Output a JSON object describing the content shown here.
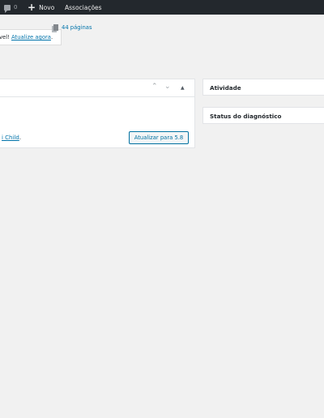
{
  "admin_bar": {
    "comments_count": "0",
    "new_label": "Novo",
    "associations_label": "Associações"
  },
  "notice": {
    "text_prefix": "vel!",
    "link_text": "Atualize agora",
    "text_suffix": "."
  },
  "main_box": {
    "pages_link": "44 páginas",
    "theme_link": "i Child",
    "theme_suffix": ".",
    "update_button": "Atualizar para 5.8"
  },
  "side_boxes": {
    "activity_title": "Atividade",
    "diagnostic_title": "Status do diagnóstico"
  },
  "colors": {
    "admin_bar_bg": "#23282d",
    "link": "#0073aa",
    "page_bg": "#f1f1f1"
  }
}
